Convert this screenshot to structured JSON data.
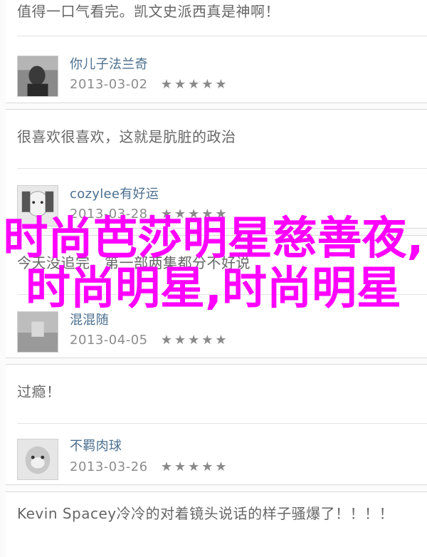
{
  "comments": [
    {
      "id": "c1",
      "text": "值得一口气看完。凯文史派西真是神啊！"
    },
    {
      "id": "c2",
      "text": "很喜欢很喜欢，这就是肮脏的政治"
    },
    {
      "id": "c3",
      "text": "今天没追完，第一部两集都分不好说"
    },
    {
      "id": "c4",
      "text": "过瘾！"
    },
    {
      "id": "c5",
      "text": "Kevin Spacey冷冷的对着镜头说话的样子骚爆了！！！！"
    }
  ],
  "reviews": [
    {
      "username": "你儿子法兰奇",
      "date": "2013-03-02",
      "stars": "★★★★★"
    },
    {
      "username": "cozylee有好运",
      "date": "2013-03-28",
      "stars": "★★★★★"
    },
    {
      "username": "混混随",
      "date": "2013-04-05",
      "stars": "★★★★★"
    },
    {
      "username": "不羁肉球",
      "date": "2013-03-26",
      "stars": "★★★★★"
    }
  ],
  "overlay": {
    "title": "时尚芭莎明星慈善夜,时尚明星,时尚明星"
  },
  "colors": {
    "overlay": "#ff00ff",
    "username": "#4a6f8f"
  }
}
